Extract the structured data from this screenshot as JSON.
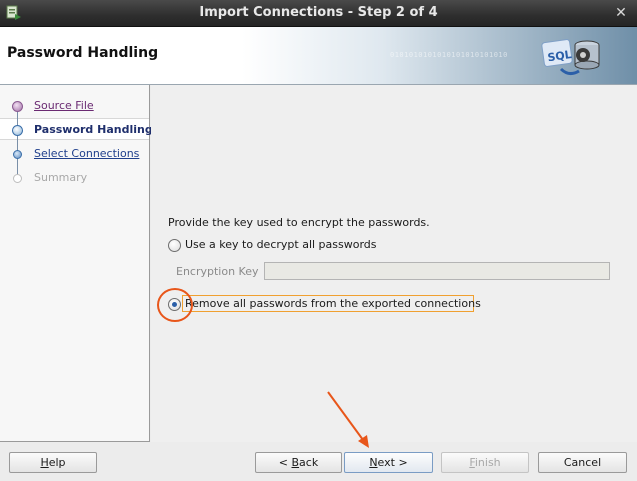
{
  "window": {
    "title": "Import Connections - Step 2 of 4",
    "close_glyph": "✕"
  },
  "header": {
    "title": "Password Handling",
    "decor_binary": "0101010101010101010101010"
  },
  "nav": {
    "items": [
      {
        "label": "Source File",
        "state": "done"
      },
      {
        "label": "Password Handling",
        "state": "current"
      },
      {
        "label": "Select Connections",
        "state": "next"
      },
      {
        "label": "Summary",
        "state": "disabled"
      }
    ]
  },
  "content": {
    "instruction": "Provide the key used to encrypt the passwords.",
    "option_key": {
      "label": "Use a key to decrypt all passwords",
      "selected": false
    },
    "encryption_key": {
      "label": "Encryption Key",
      "value": ""
    },
    "option_remove": {
      "label": "Remove all passwords from the exported connections",
      "selected": true
    }
  },
  "buttons": {
    "help": {
      "mnemonic": "H",
      "rest": "elp"
    },
    "back": {
      "prefix": "< ",
      "mnemonic": "B",
      "rest": "ack"
    },
    "next": {
      "mnemonic": "N",
      "rest": "ext >"
    },
    "finish": {
      "mnemonic": "F",
      "rest": "inish"
    },
    "cancel": {
      "label": "Cancel"
    }
  },
  "colors": {
    "annotation": "#e8561a",
    "focus": "#f0a030",
    "link": "#1f3f8c",
    "visited": "#6a2a72"
  },
  "icons": [
    "app-icon",
    "close-icon",
    "sql-database-logo",
    "radio-selected",
    "radio-unselected"
  ]
}
